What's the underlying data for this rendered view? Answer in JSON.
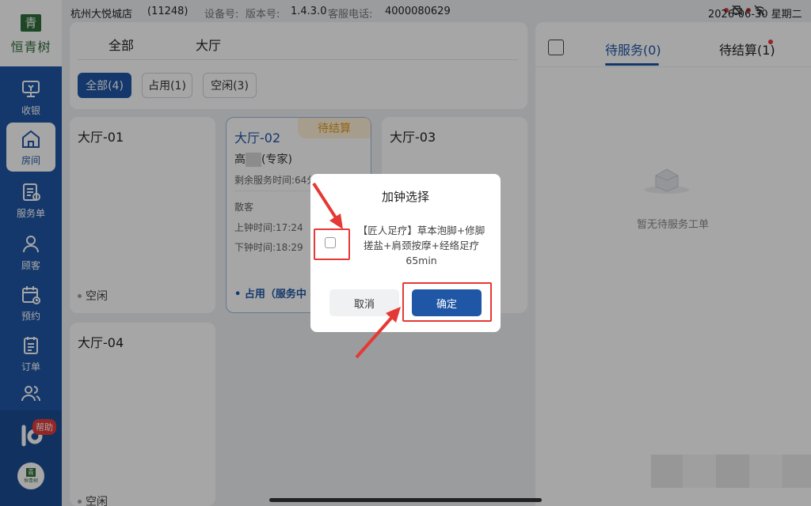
{
  "brand": {
    "logo_char": "青",
    "name": "恒青树",
    "avatar_char": "青",
    "avatar_text": "恒青树"
  },
  "status_bar": {
    "store": "杭州大悦城店",
    "store_id": "(11248)",
    "device_label": "设备号:",
    "version_label": "版本号:",
    "version": "1.4.3.0",
    "hotline_label": "客服电话:",
    "hotline": "4000080629",
    "datetime": "2026-06-30 星期二"
  },
  "sidebar": {
    "items": [
      {
        "label": "收银",
        "icon": "cashier-icon"
      },
      {
        "label": "房间",
        "icon": "home-icon",
        "active": true
      },
      {
        "label": "服务单",
        "icon": "service-order-icon"
      },
      {
        "label": "顾客",
        "icon": "customer-icon"
      },
      {
        "label": "预约",
        "icon": "calendar-icon"
      },
      {
        "label": "订单",
        "icon": "order-icon"
      },
      {
        "label": "",
        "icon": "staff-icon"
      }
    ],
    "help_badge": "帮助"
  },
  "filters": {
    "tabs": [
      "全部",
      "大厅"
    ],
    "chips": [
      {
        "label": "全部(4)",
        "active": true
      },
      {
        "label": "占用(1)"
      },
      {
        "label": "空闲(3)"
      }
    ]
  },
  "rooms": [
    {
      "name": "大厅-01",
      "status": "空闲"
    },
    {
      "name": "大厅-02",
      "tag": "待结算",
      "therapist_prefix": "高",
      "therapist_role": "(专家)",
      "remaining": "剩余服务时间:64分",
      "customer": "散客",
      "start": "上钟时间:17:24",
      "end": "下钟时间:18:29",
      "status": "• 占用（服务中"
    },
    {
      "name": "大厅-03"
    },
    {
      "name": "大厅-04",
      "status": "空闲"
    }
  ],
  "right_panel": {
    "tabs": [
      {
        "label": "待服务(0)",
        "active": true
      },
      {
        "label": "待结算(1)"
      }
    ],
    "empty_text": "暂无待服务工单"
  },
  "dialog": {
    "title": "加钟选择",
    "item": "【匠人足疗】草本泡脚+修脚搓盐+肩颈按摩+经络足疗65min",
    "cancel": "取消",
    "confirm": "确定"
  },
  "colors": {
    "primary": "#1f56a6",
    "pending": "#e09a1c",
    "annotation": "#e53935"
  }
}
